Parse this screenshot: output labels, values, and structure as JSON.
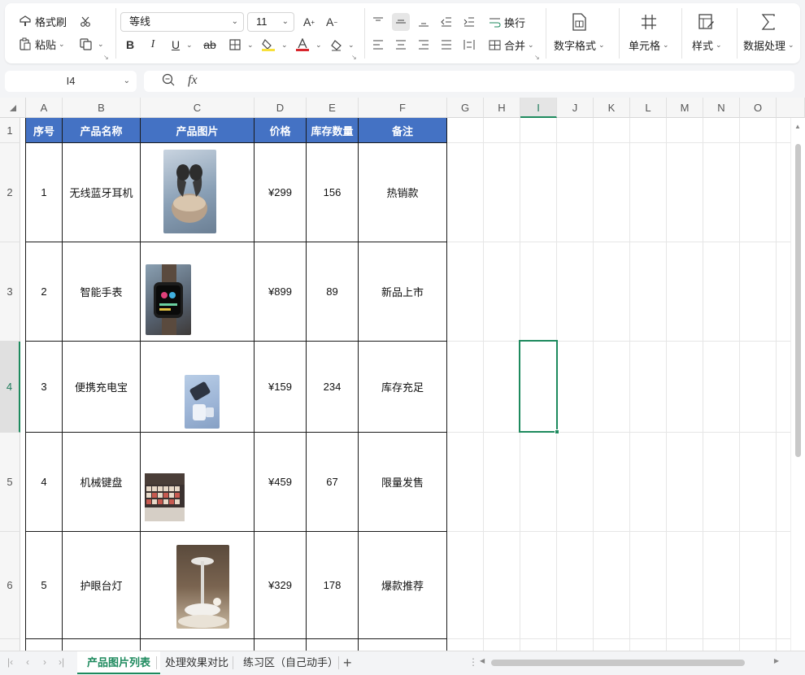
{
  "ribbon": {
    "format_painter": "格式刷",
    "paste": "粘贴",
    "font_name": "等线",
    "font_size": "11",
    "wrap_text": "换行",
    "merge": "合并",
    "number_format": "数字格式",
    "cells": "单元格",
    "styles": "样式",
    "data_processing": "数据处理"
  },
  "formula_bar": {
    "name_box": "I4",
    "fx": "fx",
    "content": ""
  },
  "columns": [
    "A",
    "B",
    "C",
    "D",
    "E",
    "F",
    "G",
    "H",
    "I",
    "J",
    "K",
    "L",
    "M",
    "N",
    "O"
  ],
  "rows": [
    "1",
    "2",
    "3",
    "4",
    "5",
    "6"
  ],
  "table": {
    "headers": [
      "序号",
      "产品名称",
      "产品图片",
      "价格",
      "库存数量",
      "备注"
    ],
    "rows": [
      {
        "id": "1",
        "name": "无线蓝牙耳机",
        "image": "wireless-earbuds",
        "price": "¥299",
        "stock": "156",
        "note": "热销款"
      },
      {
        "id": "2",
        "name": "智能手表",
        "image": "smart-watch",
        "price": "¥899",
        "stock": "89",
        "note": "新品上市"
      },
      {
        "id": "3",
        "name": "便携充电宝",
        "image": "power-bank",
        "price": "¥159",
        "stock": "234",
        "note": "库存充足"
      },
      {
        "id": "4",
        "name": "机械键盘",
        "image": "mechanical-keyboard",
        "price": "¥459",
        "stock": "67",
        "note": "限量发售"
      },
      {
        "id": "5",
        "name": "护眼台灯",
        "image": "desk-lamp",
        "price": "¥329",
        "stock": "178",
        "note": "爆款推荐"
      }
    ]
  },
  "active_cell": "I4",
  "sheets": {
    "tabs": [
      "产品图片列表",
      "处理效果对比",
      "练习区（自己动手）"
    ],
    "active": "产品图片列表",
    "add": "+"
  },
  "colors": {
    "header_fill": "#4472c4",
    "accent": "#1e8a5e"
  }
}
